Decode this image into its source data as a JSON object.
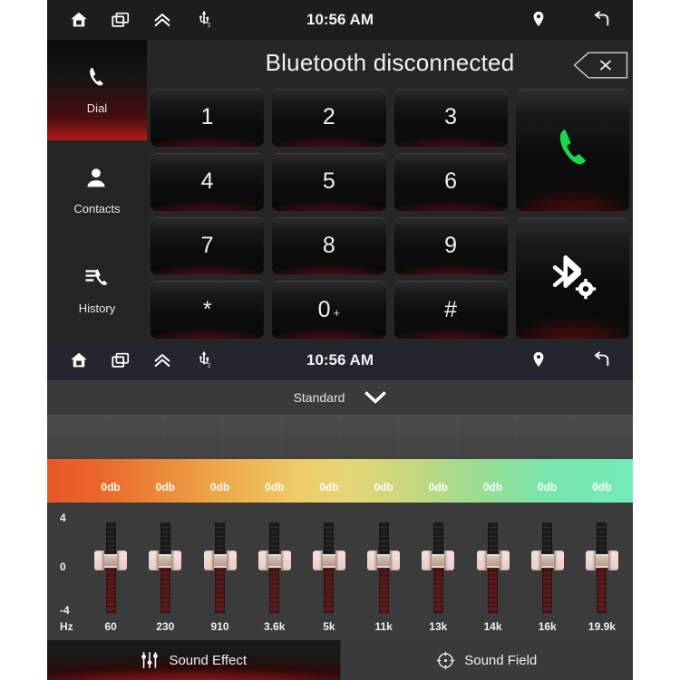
{
  "statusbar": {
    "time": "10:56 AM",
    "icons_left": [
      "home-icon",
      "recents-icon",
      "chevron-up-double-icon",
      "usb-icon"
    ],
    "icons_right": [
      "location-pin-icon",
      "back-icon"
    ],
    "usb_badge": "2"
  },
  "dialer": {
    "title": "Bluetooth disconnected",
    "backspace_label": "×",
    "sidebar": [
      {
        "label": "Dial",
        "icon": "phone-icon",
        "active": true
      },
      {
        "label": "Contacts",
        "icon": "person-icon",
        "active": false
      },
      {
        "label": "History",
        "icon": "call-history-icon",
        "active": false
      }
    ],
    "keys": [
      {
        "label": "1",
        "sub": ""
      },
      {
        "label": "2",
        "sub": ""
      },
      {
        "label": "3",
        "sub": ""
      },
      {
        "label": "4",
        "sub": ""
      },
      {
        "label": "5",
        "sub": ""
      },
      {
        "label": "6",
        "sub": ""
      },
      {
        "label": "7",
        "sub": ""
      },
      {
        "label": "8",
        "sub": ""
      },
      {
        "label": "9",
        "sub": ""
      },
      {
        "label": "*",
        "sub": ""
      },
      {
        "label": "0",
        "sub": "+"
      },
      {
        "label": "#",
        "sub": ""
      }
    ],
    "call_button": {
      "icon": "phone-call-icon",
      "color": "#19d94b"
    },
    "bt_settings_button": {
      "icon": "bluetooth-settings-icon"
    }
  },
  "equalizer": {
    "preset": "Standard",
    "preset_chevron": "chevron-down-icon",
    "axis": {
      "top": "4",
      "mid": "0",
      "bottom": "-4",
      "unit": "Hz"
    },
    "gradient": {
      "from": "#e8562a",
      "to": "#74ecb8"
    },
    "tabs": [
      {
        "label": "Sound Effect",
        "icon": "sliders-icon",
        "active": true
      },
      {
        "label": "Sound Field",
        "icon": "sound-field-icon",
        "active": false
      }
    ]
  },
  "chart_data": {
    "type": "bar",
    "title": "Standard",
    "xlabel": "Hz",
    "ylabel": "db",
    "ylim": [
      -4,
      4
    ],
    "categories": [
      "60",
      "230",
      "910",
      "3.6k",
      "5k",
      "11k",
      "13k",
      "14k",
      "16k",
      "19.9k"
    ],
    "values": [
      0,
      0,
      0,
      0,
      0,
      0,
      0,
      0,
      0,
      0
    ],
    "value_labels": [
      "0db",
      "0db",
      "0db",
      "0db",
      "0db",
      "0db",
      "0db",
      "0db",
      "0db",
      "0db"
    ],
    "ticks_y": [
      "4",
      "0",
      "-4"
    ],
    "grid": false,
    "legend": "none"
  }
}
